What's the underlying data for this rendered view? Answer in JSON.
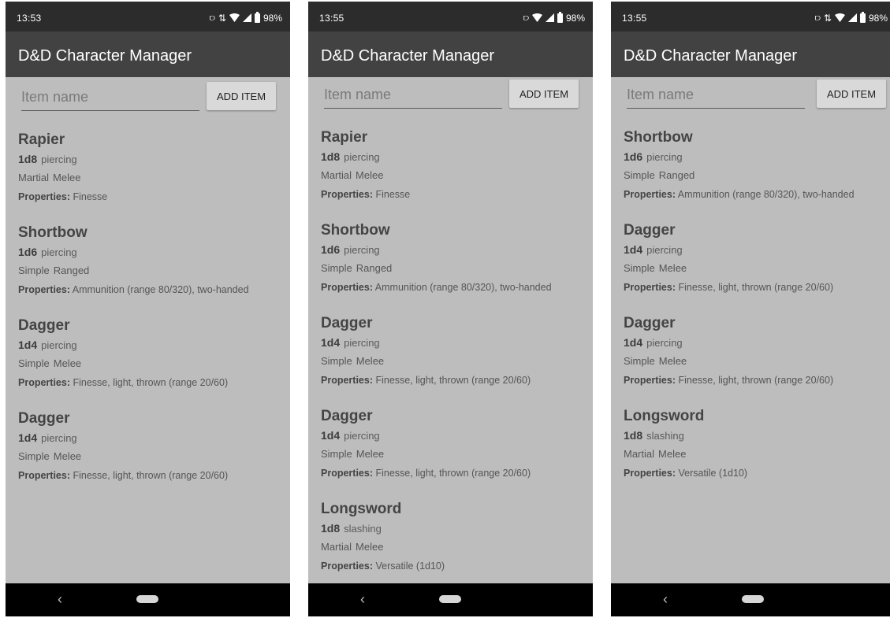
{
  "screens": [
    {
      "status": {
        "time": "13:53",
        "battery": "98%"
      },
      "app_title": "D&D Character Manager",
      "input_placeholder": "Item name",
      "add_label": "ADD ITEM",
      "items": [
        {
          "name": "Rapier",
          "dice": "1d8",
          "damage_type": "piercing",
          "category": "Martial",
          "range": "Melee",
          "properties_label": "Properties:",
          "properties": "Finesse"
        },
        {
          "name": "Shortbow",
          "dice": "1d6",
          "damage_type": "piercing",
          "category": "Simple",
          "range": "Ranged",
          "properties_label": "Properties:",
          "properties": "Ammunition (range 80/320), two-handed"
        },
        {
          "name": "Dagger",
          "dice": "1d4",
          "damage_type": "piercing",
          "category": "Simple",
          "range": "Melee",
          "properties_label": "Properties:",
          "properties": "Finesse, light, thrown (range 20/60)"
        },
        {
          "name": "Dagger",
          "dice": "1d4",
          "damage_type": "piercing",
          "category": "Simple",
          "range": "Melee",
          "properties_label": "Properties:",
          "properties": "Finesse, light, thrown (range 20/60)"
        }
      ]
    },
    {
      "status": {
        "time": "13:55",
        "battery": "98%"
      },
      "app_title": "D&D Character Manager",
      "input_placeholder": "Item name",
      "add_label": "ADD ITEM",
      "items": [
        {
          "name": "Rapier",
          "dice": "1d8",
          "damage_type": "piercing",
          "category": "Martial",
          "range": "Melee",
          "properties_label": "Properties:",
          "properties": "Finesse"
        },
        {
          "name": "Shortbow",
          "dice": "1d6",
          "damage_type": "piercing",
          "category": "Simple",
          "range": "Ranged",
          "properties_label": "Properties:",
          "properties": "Ammunition (range 80/320), two-handed"
        },
        {
          "name": "Dagger",
          "dice": "1d4",
          "damage_type": "piercing",
          "category": "Simple",
          "range": "Melee",
          "properties_label": "Properties:",
          "properties": "Finesse, light, thrown (range 20/60)"
        },
        {
          "name": "Dagger",
          "dice": "1d4",
          "damage_type": "piercing",
          "category": "Simple",
          "range": "Melee",
          "properties_label": "Properties:",
          "properties": "Finesse, light, thrown (range 20/60)"
        },
        {
          "name": "Longsword",
          "dice": "1d8",
          "damage_type": "slashing",
          "category": "Martial",
          "range": "Melee",
          "properties_label": "Properties:",
          "properties": "Versatile (1d10)"
        }
      ]
    },
    {
      "status": {
        "time": "13:55",
        "battery": "98%"
      },
      "app_title": "D&D Character Manager",
      "input_placeholder": "Item name",
      "add_label": "ADD ITEM",
      "items": [
        {
          "name": "Shortbow",
          "dice": "1d6",
          "damage_type": "piercing",
          "category": "Simple",
          "range": "Ranged",
          "properties_label": "Properties:",
          "properties": "Ammunition (range 80/320), two-handed"
        },
        {
          "name": "Dagger",
          "dice": "1d4",
          "damage_type": "piercing",
          "category": "Simple",
          "range": "Melee",
          "properties_label": "Properties:",
          "properties": "Finesse, light, thrown (range 20/60)"
        },
        {
          "name": "Dagger",
          "dice": "1d4",
          "damage_type": "piercing",
          "category": "Simple",
          "range": "Melee",
          "properties_label": "Properties:",
          "properties": "Finesse, light, thrown (range 20/60)"
        },
        {
          "name": "Longsword",
          "dice": "1d8",
          "damage_type": "slashing",
          "category": "Martial",
          "range": "Melee",
          "properties_label": "Properties:",
          "properties": "Versatile (1d10)"
        }
      ]
    }
  ],
  "icons": {
    "vibrate": "vibrate-icon",
    "data": "data-arrows-icon",
    "wifi": "wifi-icon",
    "cell": "cell-signal-icon",
    "battery": "battery-icon",
    "back": "back-icon",
    "home": "home-pill-icon"
  },
  "colors": {
    "appbar": "#424242",
    "statusbar": "#2c2c2c",
    "background": "#bdbdbd",
    "navbar": "#000000",
    "button": "#d9d9d9"
  }
}
